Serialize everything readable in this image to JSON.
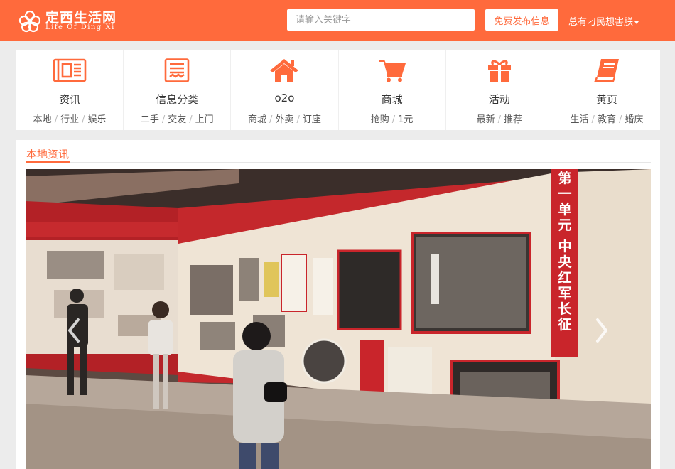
{
  "header": {
    "logo_title": "定西生活网",
    "logo_subtitle": "Life Of Ding Xi",
    "search_placeholder": "请输入关键字",
    "publish_label": "免费发布信息",
    "user_name": "总有刁民想害朕"
  },
  "colors": {
    "accent": "#ff6a3c",
    "page_bg": "#ececec",
    "panel_bg": "#ffffff"
  },
  "nav": [
    {
      "icon": "news-icon",
      "title": "资讯",
      "links": [
        "本地",
        "行业",
        "娱乐"
      ]
    },
    {
      "icon": "classified-icon",
      "title": "信息分类",
      "links": [
        "二手",
        "交友",
        "上门"
      ]
    },
    {
      "icon": "home-icon",
      "title": "o2o",
      "links": [
        "商城",
        "外卖",
        "订座"
      ]
    },
    {
      "icon": "cart-icon",
      "title": "商城",
      "links": [
        "抢购",
        "1元"
      ]
    },
    {
      "icon": "gift-icon",
      "title": "活动",
      "links": [
        "最新",
        "推荐"
      ]
    },
    {
      "icon": "book-icon",
      "title": "黄页",
      "links": [
        "生活",
        "教育",
        "婚庆"
      ]
    }
  ],
  "local_news": {
    "title": "本地资讯",
    "slide": {
      "image": "exhibition-photo",
      "panel_title": "第一单元",
      "panel_subtitle": "中央红军长征"
    }
  }
}
